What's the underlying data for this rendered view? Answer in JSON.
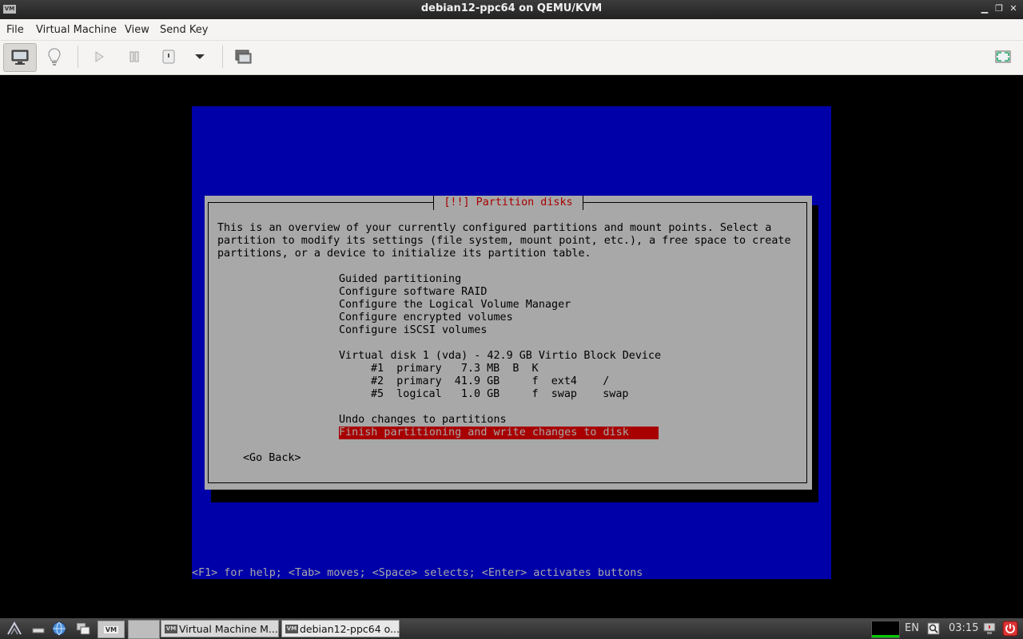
{
  "window": {
    "title": "debian12-ppc64 on QEMU/KVM",
    "logo_text": "VM",
    "minimize_glyph": "▁",
    "restore_glyph": "❐",
    "close_glyph": "✕"
  },
  "menubar": {
    "items": [
      "File",
      "Virtual Machine",
      "View",
      "Send Key"
    ]
  },
  "toolbar": {
    "buttons": [
      "console-icon",
      "lightbulb-icon",
      "run-icon",
      "pause-icon",
      "power-icon",
      "dropdown-icon",
      "snapshot-icon",
      "fullscreen-icon"
    ]
  },
  "installer": {
    "dialog_title": "[!!] Partition disks",
    "intro_lines": [
      "This is an overview of your currently configured partitions and mount points. Select a",
      "partition to modify its settings (file system, mount point, etc.), a free space to create",
      "partitions, or a device to initialize its partition table."
    ],
    "menu": [
      "Guided partitioning",
      "Configure software RAID",
      "Configure the Logical Volume Manager",
      "Configure encrypted volumes",
      "Configure iSCSI volumes"
    ],
    "disk": {
      "label": "Virtual disk 1 (vda) - 42.9 GB Virtio Block Device",
      "partitions": [
        "#1  primary   7.3 MB  B  K",
        "#2  primary  41.9 GB     f  ext4    /",
        "#5  logical   1.0 GB     f  swap    swap"
      ]
    },
    "undo": "Undo changes to partitions",
    "finish": "Finish partitioning and write changes to disk",
    "go_back": "<Go Back>",
    "help": "<F1> for help; <Tab> moves; <Space> selects; <Enter> activates buttons"
  },
  "taskbar": {
    "tasks": [
      {
        "label": "Virtual Machine M...",
        "icon_text": "VM"
      },
      {
        "label": "debian12-ppc64 o...",
        "icon_text": "VM"
      }
    ],
    "keyboard_layout": "EN",
    "clock": "03:15",
    "quick_launch_badge": "VM"
  },
  "colors": {
    "installer_bg": "#0000a8",
    "dialog_bg": "#a8a8a8",
    "title_red": "#a80000",
    "selection_red": "#a80000"
  }
}
